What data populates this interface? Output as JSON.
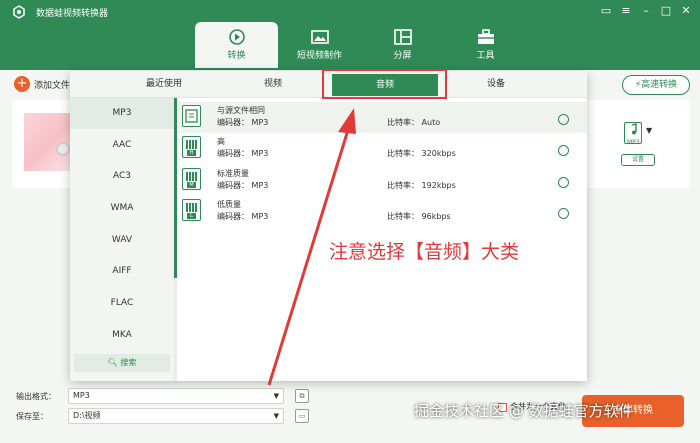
{
  "app": {
    "title": "数据蛙视频转换器"
  },
  "nav": {
    "tabs": [
      "转换",
      "短视频制作",
      "分屏",
      "工具"
    ]
  },
  "toolbar": {
    "add_file": "添加文件",
    "fast_convert": "高速转换"
  },
  "output_icon": {
    "format": "MP3",
    "setting": "设置"
  },
  "popup": {
    "tabs": [
      "最近使用",
      "视频",
      "音频",
      "设备"
    ],
    "active_tab": "音频",
    "formats": [
      "MP3",
      "AAC",
      "AC3",
      "WMA",
      "WAV",
      "AIFF",
      "FLAC",
      "MKA"
    ],
    "active_format": "MP3",
    "search_label": "搜索",
    "qualities": [
      {
        "name": "与源文件相同",
        "encoder_label": "编码器：",
        "encoder": "MP3",
        "bitrate_label": "比特率：",
        "bitrate": "Auto",
        "icon_letter": ""
      },
      {
        "name": "高",
        "encoder_label": "编码器：",
        "encoder": "MP3",
        "bitrate_label": "比特率：",
        "bitrate": "320kbps",
        "icon_letter": "H"
      },
      {
        "name": "标准质量",
        "encoder_label": "编码器：",
        "encoder": "MP3",
        "bitrate_label": "比特率：",
        "bitrate": "192kbps",
        "icon_letter": "M"
      },
      {
        "name": "低质量",
        "encoder_label": "编码器：",
        "encoder": "MP3",
        "bitrate_label": "比特率：",
        "bitrate": "96kbps",
        "icon_letter": "L"
      }
    ]
  },
  "bottom": {
    "output_format_label": "输出格式：",
    "output_format_value": "MP3",
    "save_to_label": "保存至：",
    "save_to_value": "D:\\视频",
    "merge_label": "合并为一个文件",
    "convert_all": "全部转换"
  },
  "annotation": "注意选择【音频】大类",
  "watermark": "掘金技术社区 @ 数据蛙官方软件",
  "colors": {
    "brand": "#2f8a55",
    "accent": "#e9602a",
    "annotation": "#e03a3a"
  }
}
